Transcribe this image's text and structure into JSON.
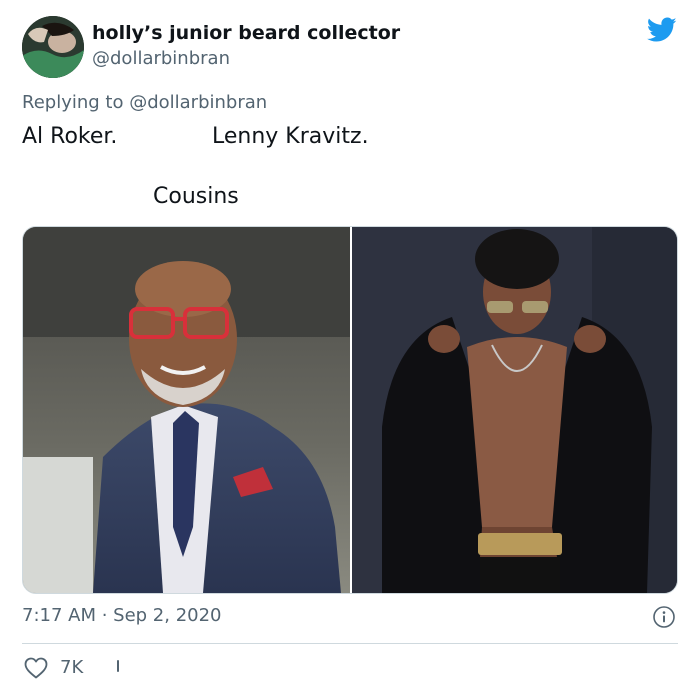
{
  "author": {
    "display_name": "holly’s junior beard collector",
    "handle": "@dollarbinbran"
  },
  "reply": {
    "prefix": "Replying to ",
    "to": "@dollarbinbran"
  },
  "tweet_text": {
    "line1_left": "Al Roker.",
    "line1_right": "Lenny Kravitz.",
    "line2": "Cousins"
  },
  "timestamp": "7:17 AM · Sep 2, 2020",
  "actions": {
    "like_count": "7K"
  },
  "colors": {
    "twitter_blue": "#1d9bf0",
    "secondary_text": "#536471",
    "primary_text": "#0f1419",
    "divider": "#cfd9de"
  },
  "icons": {
    "brand": "twitter-bird-icon",
    "info": "info-icon",
    "like": "heart-icon"
  }
}
